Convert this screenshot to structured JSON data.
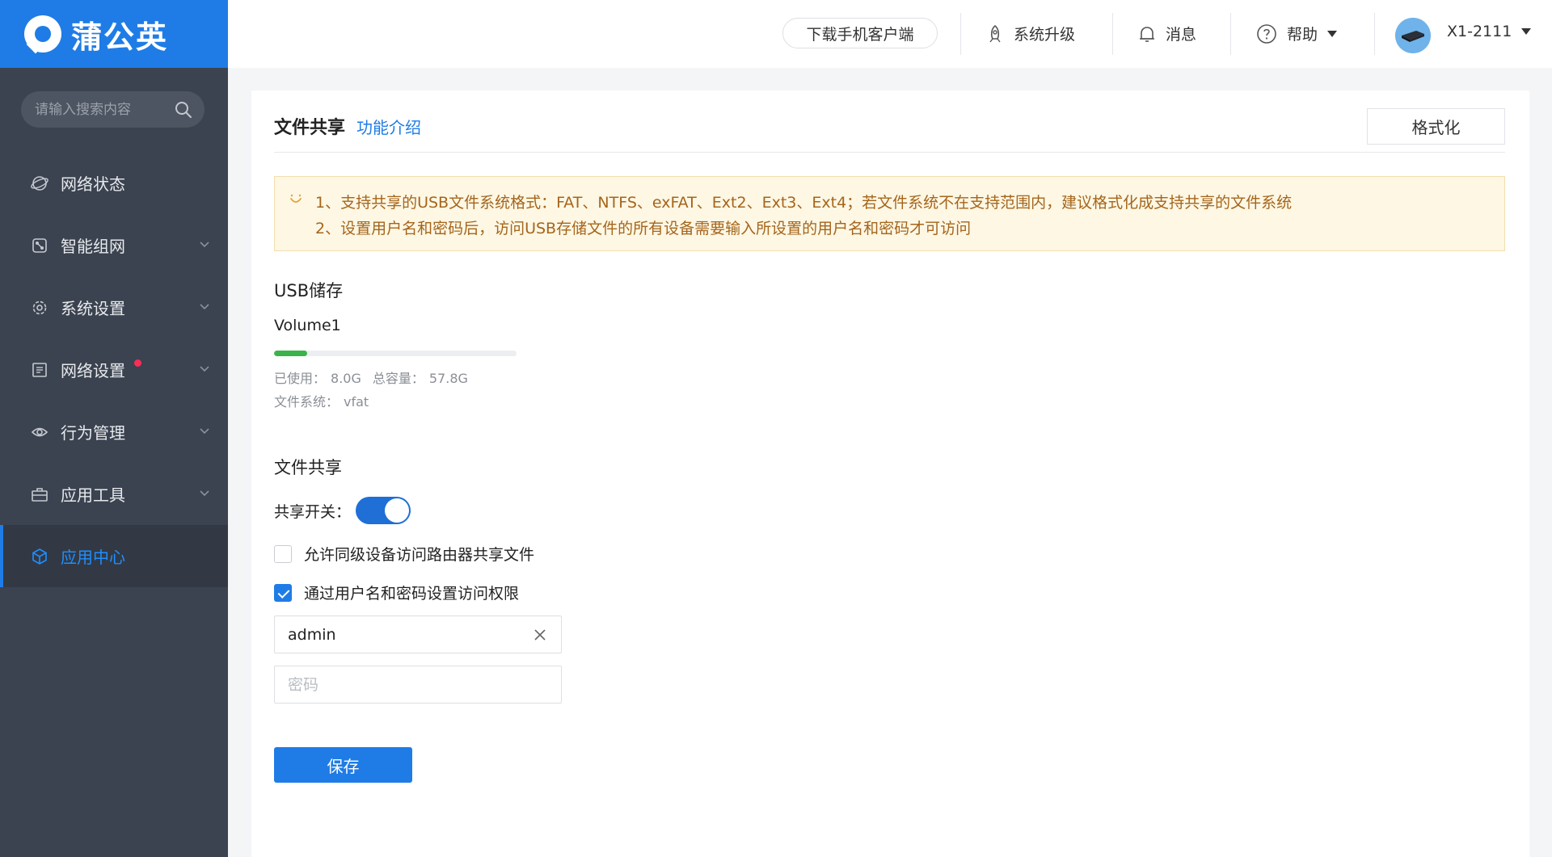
{
  "brand": {
    "name": "蒲公英"
  },
  "sidebar": {
    "search_placeholder": "请输入搜索内容",
    "items": [
      {
        "label": "网络状态",
        "icon": "globe-icon",
        "has_children": false
      },
      {
        "label": "智能组网",
        "icon": "network-icon",
        "has_children": true
      },
      {
        "label": "系统设置",
        "icon": "gear-icon",
        "has_children": true
      },
      {
        "label": "网络设置",
        "icon": "list-icon",
        "has_children": true,
        "badge_dot": true
      },
      {
        "label": "行为管理",
        "icon": "eye-icon",
        "has_children": true
      },
      {
        "label": "应用工具",
        "icon": "toolbox-icon",
        "has_children": true
      },
      {
        "label": "应用中心",
        "icon": "cube-icon",
        "has_children": false,
        "active": true
      }
    ]
  },
  "header": {
    "download_label": "下载手机客户端",
    "upgrade_label": "系统升级",
    "messages_label": "消息",
    "help_label": "帮助",
    "device_name": "X1-2111"
  },
  "page": {
    "title": "文件共享",
    "intro_link": "功能介绍",
    "format_button": "格式化",
    "notice": {
      "line1": "1、支持共享的USB文件系统格式：FAT、NTFS、exFAT、Ext2、Ext3、Ext4；若文件系统不在支持范围内，建议格式化成支持共享的文件系统",
      "line2": "2、设置用户名和密码后，访问USB存储文件的所有设备需要输入所设置的用户名和密码才可访问"
    },
    "usb": {
      "section_title": "USB储存",
      "volume_name": "Volume1",
      "used_label": "已使用：",
      "used_value": "8.0G",
      "total_label": "总容量：",
      "total_value": "57.8G",
      "usage_fraction": 0.138,
      "fs_label": "文件系统：",
      "fs_value": "vfat"
    },
    "sharing": {
      "section_title": "文件共享",
      "switch_label": "共享开关：",
      "switch_on": true,
      "allow_same_level_label": "允许同级设备访问路由器共享文件",
      "allow_same_level_checked": false,
      "auth_label": "通过用户名和密码设置访问权限",
      "auth_checked": true,
      "username_value": "admin",
      "password_placeholder": "密码",
      "save_label": "保存"
    }
  },
  "colors": {
    "primary": "#1f7ce6",
    "sidebar_bg": "#3b4350",
    "notice_text": "#a5651b",
    "usage_bar": "#3ab44a"
  }
}
